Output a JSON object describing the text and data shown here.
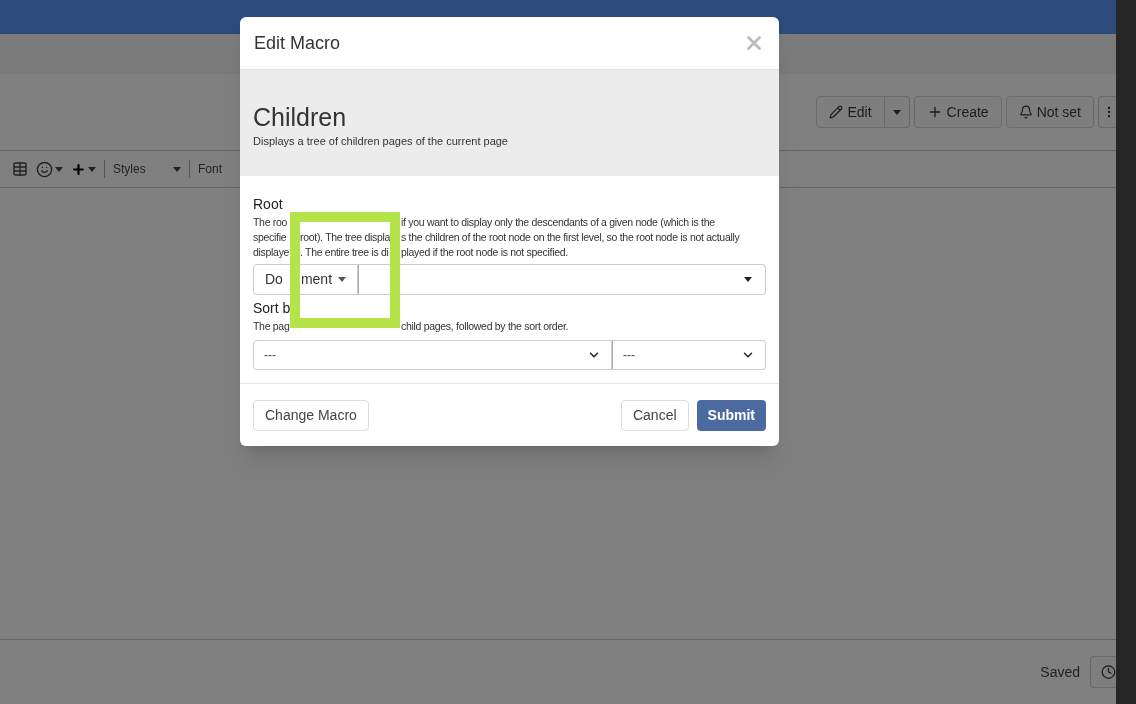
{
  "page": {
    "actions": [
      {
        "label": "Edit",
        "kind": "split"
      },
      {
        "label": "Create",
        "kind": "create"
      },
      {
        "label": "Not set",
        "kind": "watch"
      },
      {
        "kind": "more"
      }
    ],
    "editor_toolbar": {
      "styles": "Styles",
      "font": "Font"
    },
    "status": "Saved"
  },
  "modal": {
    "title": "Edit Macro",
    "macro_name": "Children",
    "macro_description": "Displays a tree of children pages of the current page",
    "fields": [
      {
        "kind": "node-picker",
        "label": "Root",
        "hint_lines": [
          {
            "segments": [
              {
                "kind": "before",
                "text": "The roo"
              },
              {
                "kind": "after",
                "text": "if you want to display only the descendants of a given node (which is the"
              }
            ]
          },
          {
            "segments": [
              {
                "kind": "before",
                "text": "specifie"
              },
              {
                "kind": "inside",
                "text": "root). The tree displa"
              },
              {
                "kind": "after",
                "text": "s the children of the root node on the first level, so the root node is not actually"
              }
            ]
          },
          {
            "segments": [
              {
                "kind": "before",
                "text": "displaye"
              },
              {
                "kind": "inside",
                "text": ". The entire tree is di"
              },
              {
                "kind": "after",
                "text": "played if the root node is not specified."
              }
            ]
          }
        ],
        "type_button_parts": [
          "Do",
          "ment"
        ]
      },
      {
        "kind": "sort",
        "label": "Sort b",
        "hint_lines": [
          {
            "segments": [
              {
                "kind": "before",
                "text": "The pag"
              },
              {
                "kind": "after",
                "text": "child pages, followed by the sort order."
              }
            ]
          }
        ],
        "selects": [
          "---",
          "---"
        ]
      }
    ],
    "buttons": [
      {
        "label": "Change Macro",
        "kind": "secondary"
      },
      {
        "label": "Cancel",
        "kind": "secondary"
      },
      {
        "label": "Submit",
        "kind": "primary"
      }
    ]
  }
}
